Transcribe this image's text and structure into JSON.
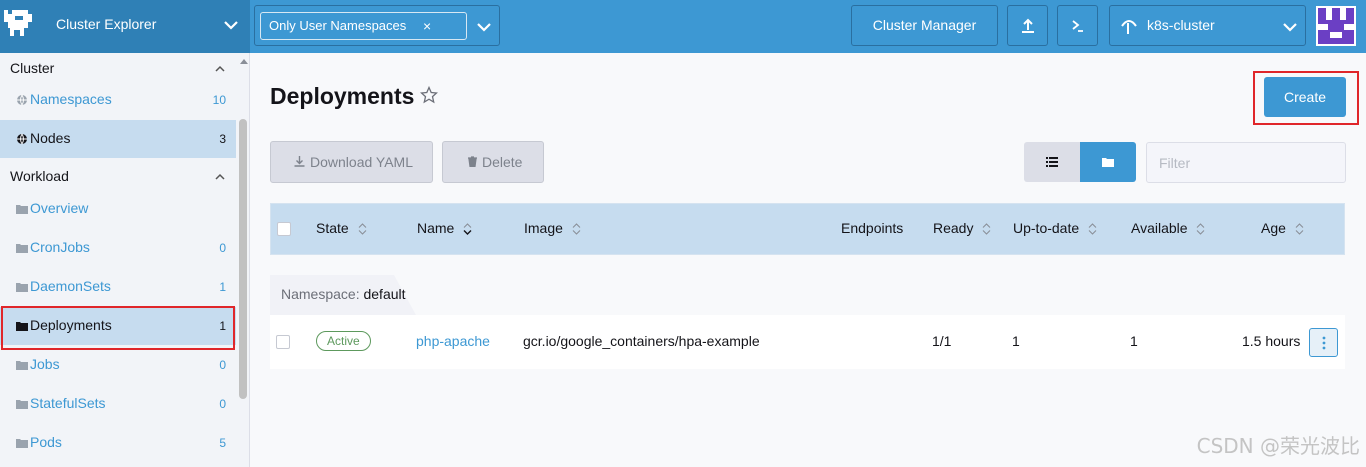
{
  "header": {
    "app_title": "Cluster Explorer",
    "namespace_filter": "Only User Namespaces",
    "namespace_clear": "×",
    "cluster_manager_label": "Cluster Manager",
    "cluster_name": "k8s-cluster",
    "brand_color": "#3d98d3",
    "brand_dark": "#2f80b6"
  },
  "sidebar": {
    "groups": [
      {
        "title": "Cluster",
        "items": [
          {
            "label": "Namespaces",
            "count": "10",
            "icon": "globe-icon"
          },
          {
            "label": "Nodes",
            "count": "3",
            "icon": "globe-icon",
            "active": true
          }
        ]
      },
      {
        "title": "Workload",
        "items": [
          {
            "label": "Overview",
            "count": "",
            "icon": "folder-icon"
          },
          {
            "label": "CronJobs",
            "count": "0",
            "icon": "folder-icon"
          },
          {
            "label": "DaemonSets",
            "count": "1",
            "icon": "folder-icon"
          },
          {
            "label": "Deployments",
            "count": "1",
            "icon": "folder-icon",
            "active": true,
            "highlighted": true
          },
          {
            "label": "Jobs",
            "count": "0",
            "icon": "folder-icon"
          },
          {
            "label": "StatefulSets",
            "count": "0",
            "icon": "folder-icon"
          },
          {
            "label": "Pods",
            "count": "5",
            "icon": "folder-icon"
          }
        ]
      }
    ]
  },
  "main": {
    "title": "Deployments",
    "create_label": "Create",
    "download_yaml_label": "Download YAML",
    "delete_label": "Delete",
    "filter_placeholder": "Filter",
    "table": {
      "columns": [
        "State",
        "Name",
        "Image",
        "Endpoints",
        "Ready",
        "Up-to-date",
        "Available",
        "Age"
      ],
      "group_label": "Namespace:",
      "group_value": "default",
      "rows": [
        {
          "state": "Active",
          "name": "php-apache",
          "image": "gcr.io/google_containers/hpa-example",
          "endpoints": "",
          "ready": "1/1",
          "up_to_date": "1",
          "available": "1",
          "age": "1.5 hours"
        }
      ]
    }
  },
  "watermark": "CSDN @荣光波比"
}
